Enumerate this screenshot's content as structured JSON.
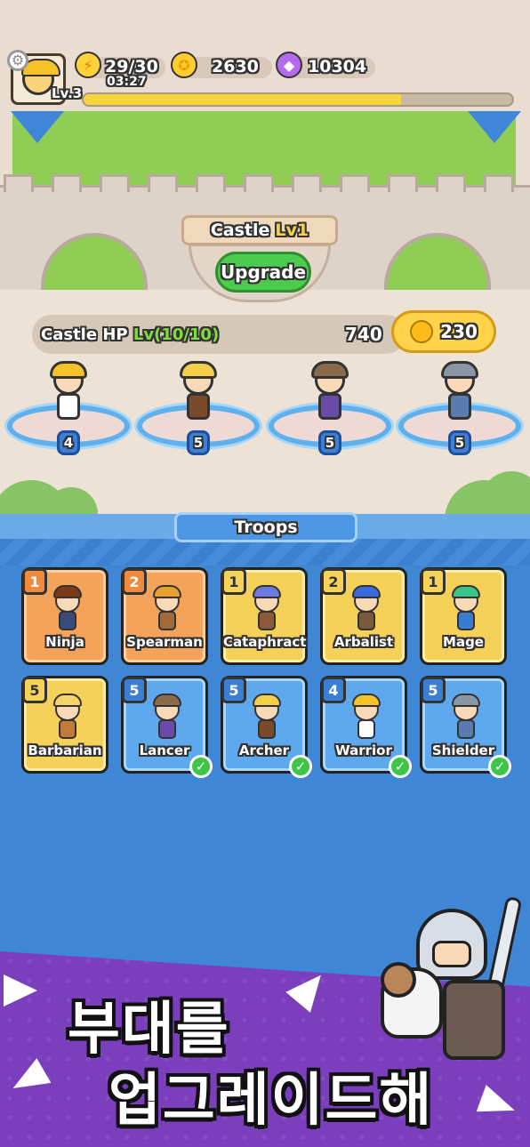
{
  "header": {
    "level": "Lv.3",
    "energy": "29/30",
    "energy_timer": "03:27",
    "gold": "2630",
    "gems": "10304",
    "xp_progress": 0.74
  },
  "castle": {
    "title": "Castle",
    "title_level": "Lv1",
    "upgrade_label": "Upgrade",
    "hp_label": "Castle HP",
    "hp_level": "Lv(10/10)",
    "hp_value": "740",
    "hp_cost": "230"
  },
  "heroes": [
    {
      "name": "Warrior",
      "level": "4",
      "hair": "#f5c328",
      "body": "#ffffff"
    },
    {
      "name": "Archer",
      "level": "5",
      "hair": "#f3cf4a",
      "body": "#7a4a2a"
    },
    {
      "name": "Lancer",
      "level": "5",
      "hair": "#8a6a4a",
      "body": "#6a4ca8"
    },
    {
      "name": "Shielder",
      "level": "5",
      "hair": "#8a96a6",
      "body": "#5a7ab0"
    }
  ],
  "troops": {
    "title": "Troops",
    "cards": [
      {
        "name": "Ninja",
        "level": "1",
        "theme": "orange",
        "owned": false,
        "hair": "#7a3a1a",
        "body": "#3a4a7a"
      },
      {
        "name": "Spearman",
        "level": "2",
        "theme": "orange",
        "owned": false,
        "hair": "#e6a030",
        "body": "#a06a3a"
      },
      {
        "name": "Cataphract",
        "level": "1",
        "theme": "yellow",
        "owned": false,
        "hair": "#6a7ae0",
        "body": "#8a5a3a"
      },
      {
        "name": "Arbalist",
        "level": "2",
        "theme": "yellow",
        "owned": false,
        "hair": "#3a6ae0",
        "body": "#7a5a3a"
      },
      {
        "name": "Mage",
        "level": "1",
        "theme": "yellow",
        "owned": false,
        "hair": "#3ac48a",
        "body": "#3a7ad0"
      },
      {
        "name": "Barbarian",
        "level": "5",
        "theme": "yellow",
        "owned": false,
        "hair": "#f5d56a",
        "body": "#c07a3a"
      },
      {
        "name": "Lancer",
        "level": "5",
        "theme": "blue",
        "owned": true,
        "hair": "#8a6a4a",
        "body": "#6a4ca8"
      },
      {
        "name": "Archer",
        "level": "5",
        "theme": "blue",
        "owned": true,
        "hair": "#f3cf4a",
        "body": "#7a4a2a"
      },
      {
        "name": "Warrior",
        "level": "4",
        "theme": "blue",
        "owned": true,
        "hair": "#f5c328",
        "body": "#ffffff"
      },
      {
        "name": "Shielder",
        "level": "5",
        "theme": "blue",
        "owned": true,
        "hair": "#8a96a6",
        "body": "#5a7ab0"
      }
    ]
  },
  "promo": {
    "line1": "부대를",
    "line2": "업그레이드해"
  },
  "colors": {
    "panel_blue": "#3f86d4",
    "promo_purple": "#7b3fbe",
    "accent_green": "#4ccc4e",
    "gold": "#ffd44a"
  },
  "icons": [
    "gear-icon",
    "energy-icon",
    "gold-coin-icon",
    "gem-icon",
    "check-icon"
  ]
}
